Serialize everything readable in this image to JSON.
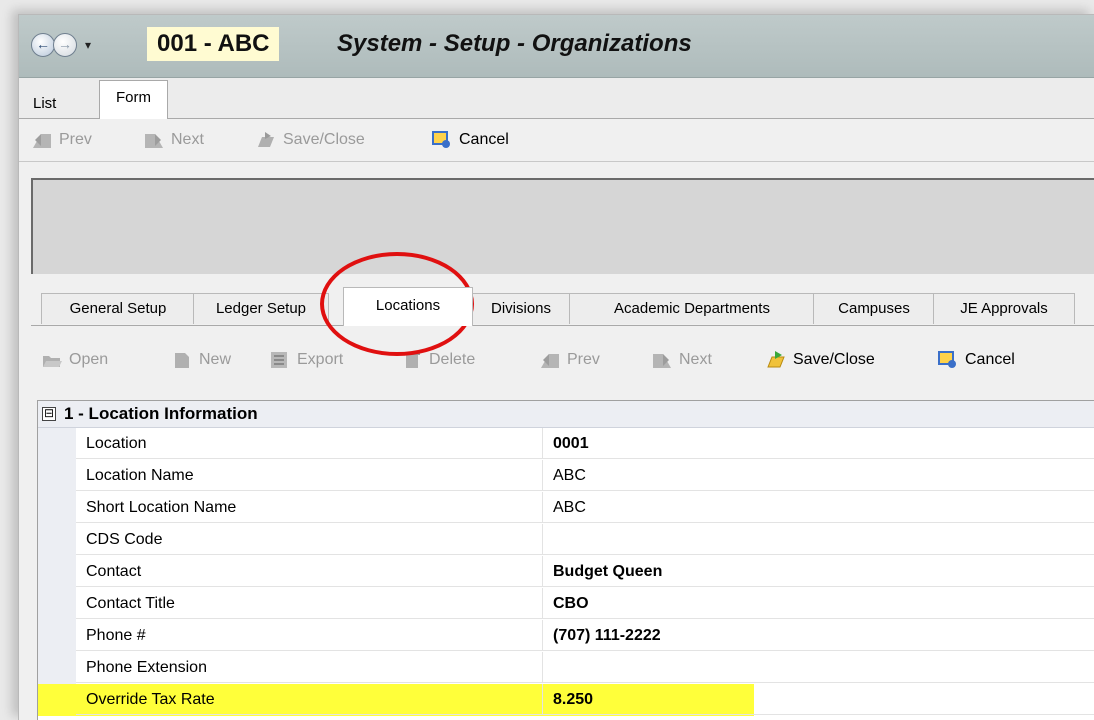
{
  "header": {
    "org_code": "001 - ABC",
    "title": "System - Setup - Organizations"
  },
  "top_tabs": [
    {
      "label": "List"
    },
    {
      "label": "Form"
    }
  ],
  "toolbar1": {
    "prev": "Prev",
    "next": "Next",
    "save_close": "Save/Close",
    "cancel": "Cancel"
  },
  "inner_tabs": [
    {
      "label": "General Setup"
    },
    {
      "label": "Ledger Setup"
    },
    {
      "label": "Locations"
    },
    {
      "label": "Divisions"
    },
    {
      "label": "Academic Departments"
    },
    {
      "label": "Campuses"
    },
    {
      "label": "JE Approvals"
    }
  ],
  "toolbar2": {
    "open": "Open",
    "new": "New",
    "export": "Export",
    "delete": "Delete",
    "prev": "Prev",
    "next": "Next",
    "save_close": "Save/Close",
    "cancel": "Cancel"
  },
  "grid": {
    "category": "1 - Location Information",
    "toggle": "⊟",
    "rows": [
      {
        "name": "Location",
        "value": "0001"
      },
      {
        "name": "Location Name",
        "value": "ABC"
      },
      {
        "name": "Short Location Name",
        "value": "ABC"
      },
      {
        "name": "CDS Code",
        "value": ""
      },
      {
        "name": "Contact",
        "value": "Budget Queen"
      },
      {
        "name": "Contact Title",
        "value": "CBO"
      },
      {
        "name": "Phone #",
        "value": "(707) 111-2222"
      },
      {
        "name": "Phone Extension",
        "value": ""
      },
      {
        "name": "Override Tax Rate",
        "value": "8.250"
      }
    ]
  },
  "colors": {
    "highlight": "#ffff3a",
    "annotation": "#e01010",
    "org_code_bg": "#fffbd2"
  }
}
